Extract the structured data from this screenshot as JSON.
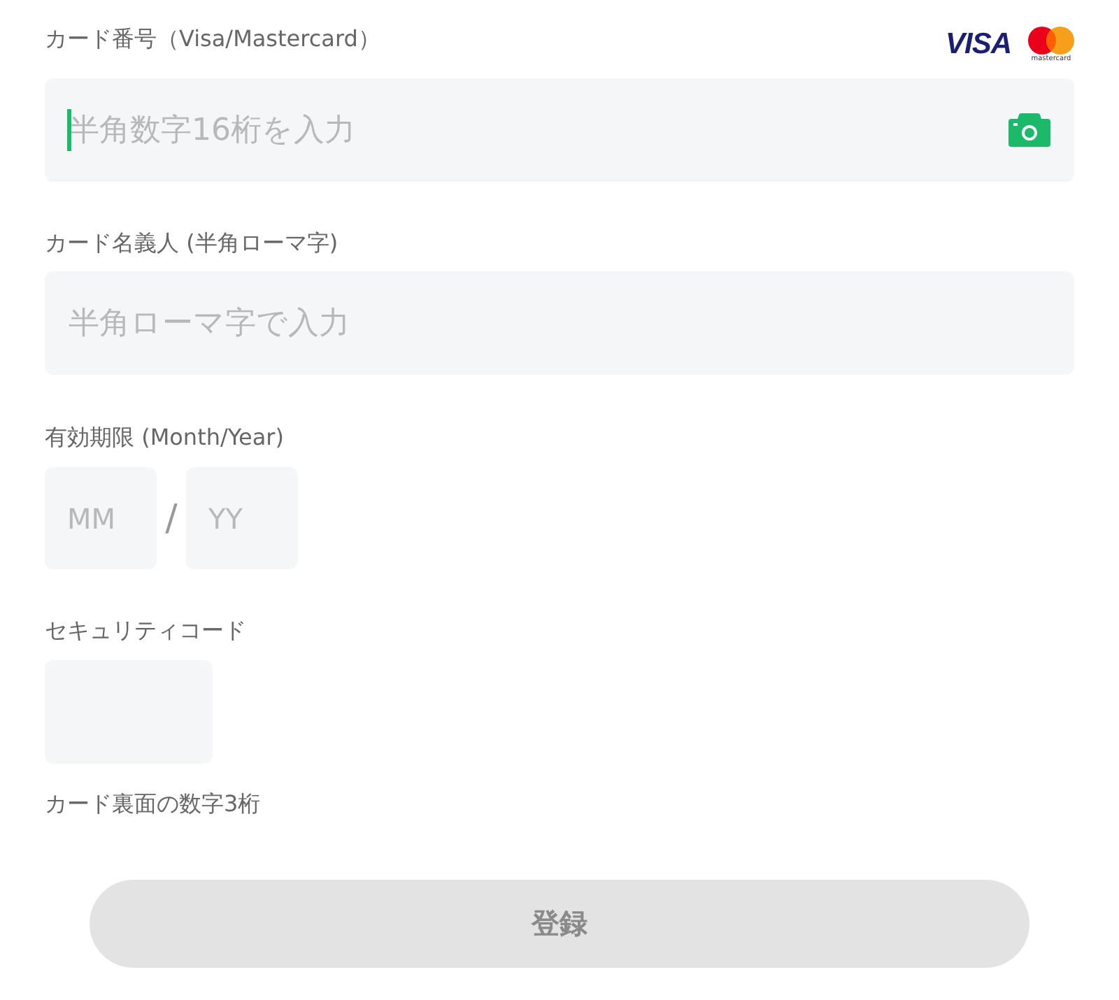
{
  "card_number": {
    "label": "カード番号（Visa/Mastercard）",
    "brands": [
      {
        "kind": "visa",
        "label": "VISA"
      },
      {
        "kind": "mastercard",
        "label": "mastercard"
      }
    ],
    "placeholder": "半角数字16桁を入力",
    "focused": true
  },
  "cardholder": {
    "label": "カード名義人 (半角ローマ字)",
    "placeholder": "半角ローマ字で入力"
  },
  "expiry": {
    "label": "有効期限 (Month/Year)",
    "month_placeholder": "MM",
    "separator": "/",
    "year_placeholder": "YY"
  },
  "security_code": {
    "label": "セキュリティコード",
    "hint": "カード裏面の数字3桁"
  },
  "submit_button": {
    "label": "登録",
    "disabled": true
  }
}
